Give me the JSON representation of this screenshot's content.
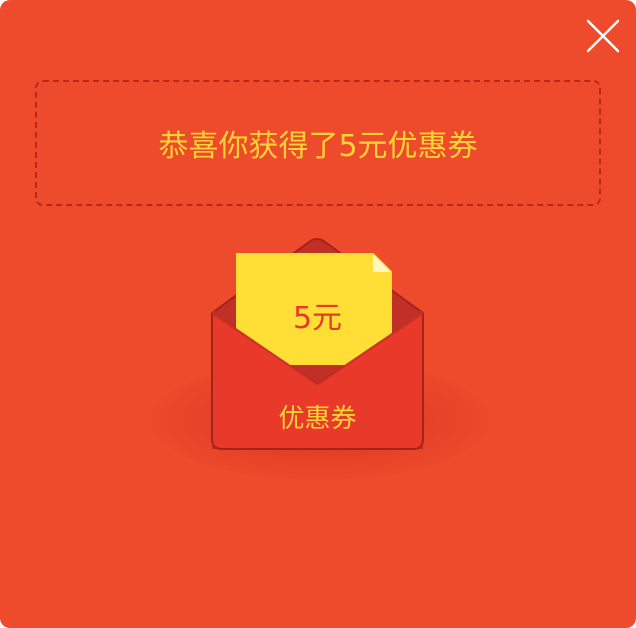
{
  "dialog": {
    "message": "恭喜你获得了5元优惠券",
    "coupon_amount": "5元",
    "coupon_label": "优惠券",
    "close_icon": "close-icon"
  },
  "colors": {
    "background": "#ee4a2c",
    "accent_yellow": "#ffd335",
    "envelope_red": "#e8392a",
    "border_dark_red": "#b8291b"
  }
}
